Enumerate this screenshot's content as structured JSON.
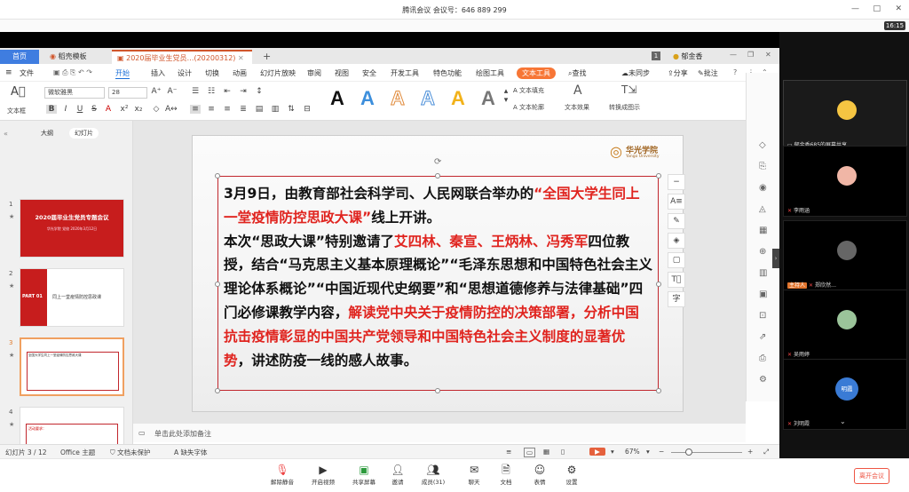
{
  "meeting": {
    "title": "腾讯会议 会议号：646 889 299",
    "clock": "16:15",
    "window_controls": [
      "—",
      "□",
      "✕"
    ]
  },
  "wps": {
    "tabs": {
      "home": "首页",
      "daoke": "稻壳模板",
      "doc": "2020届毕业生党员…(20200312)",
      "plus": "+"
    },
    "tab_right": {
      "page_badge": "1",
      "user": "郁金香"
    },
    "menu": [
      "文件",
      "开始",
      "插入",
      "设计",
      "切换",
      "动画",
      "幻灯片放映",
      "审阅",
      "视图",
      "安全",
      "开发工具",
      "特色功能",
      "绘图工具",
      "文本工具"
    ],
    "menu_right": {
      "search": "查找",
      "sync": "未同步",
      "share": "分享",
      "comment": "批注"
    },
    "ribbon": {
      "text_box": "文本框",
      "font": "微软雅黑",
      "size": "28",
      "fill": "文本填充",
      "outline": "文本轮廓",
      "effect": "文本效果",
      "transform": "转换成图示"
    },
    "thumbs": {
      "tab_outline": "大纲",
      "tab_slides": "幻灯片",
      "slides": [
        {
          "num": "1",
          "title": "2020届毕业生党员专题会议",
          "sub": "华光学院 党校 2020年3月12日"
        },
        {
          "num": "2",
          "label": "PART 01",
          "title": "同上一堂疫情防控思政课"
        },
        {
          "num": "3",
          "title": "全国大学生同上一堂疫情防控思政大课"
        },
        {
          "num": "4",
          "title": "活动要求："
        }
      ],
      "add": "+"
    },
    "slide": {
      "logo_text": "华光学院",
      "logo_sub": "Yango University",
      "p1": "3月9日，由教育部社会科学司、人民网联合举办的",
      "p1_red": "“全国大学生同上一堂疫情防控思政大课”",
      "p1_end": "线上开讲。",
      "p2": "本次“思政大课”特别邀请了",
      "p2_red": "艾四林、秦宣、王炳林、冯秀军",
      "p2_mid": "四位教授，结合“马克思主义基本原理概论”“毛泽东思想和中国特色社会主义理论体系概论”“中国近现代史纲要”和“思想道德修养与法律基础”四门必修课教学内容，",
      "p2_red2": "解读党中央关于疫情防控的决策部署，分析中国抗击疫情彰显的中国共产党领导和中国特色社会主义制度的显著优势",
      "p2_end": "，讲述防疫一线的感人故事。"
    },
    "notes": "单击此处添加备注",
    "status": {
      "slide_count": "幻灯片 3 / 12",
      "theme": "Office 主题",
      "protect": "文档未保护",
      "missing_font": "缺失字体",
      "zoom": "67%"
    }
  },
  "participants": [
    {
      "name": "郁金香685的屏幕共享",
      "avatar_color": "#f5c542"
    },
    {
      "name": "李雨涵",
      "avatar_color": "#f0b6a6"
    },
    {
      "name": "郑欣然…",
      "host": "主持人",
      "avatar_color": "#666666"
    },
    {
      "name": "吴雨婷",
      "avatar_color": "#9bc49a"
    },
    {
      "name": "刘明霞",
      "avatar_color": "#3a7bd5",
      "avatar_text": "明霞"
    }
  ],
  "bottombar": {
    "items": [
      "解除静音",
      "开启视频",
      "共享屏幕",
      "邀请",
      "成员(31)",
      "聊天",
      "文档",
      "表情",
      "设置"
    ],
    "leave": "离开会议"
  },
  "colors": {
    "accent_red": "#e0241f",
    "wps_orange": "#f77636",
    "wps_blue": "#3f7de0"
  }
}
